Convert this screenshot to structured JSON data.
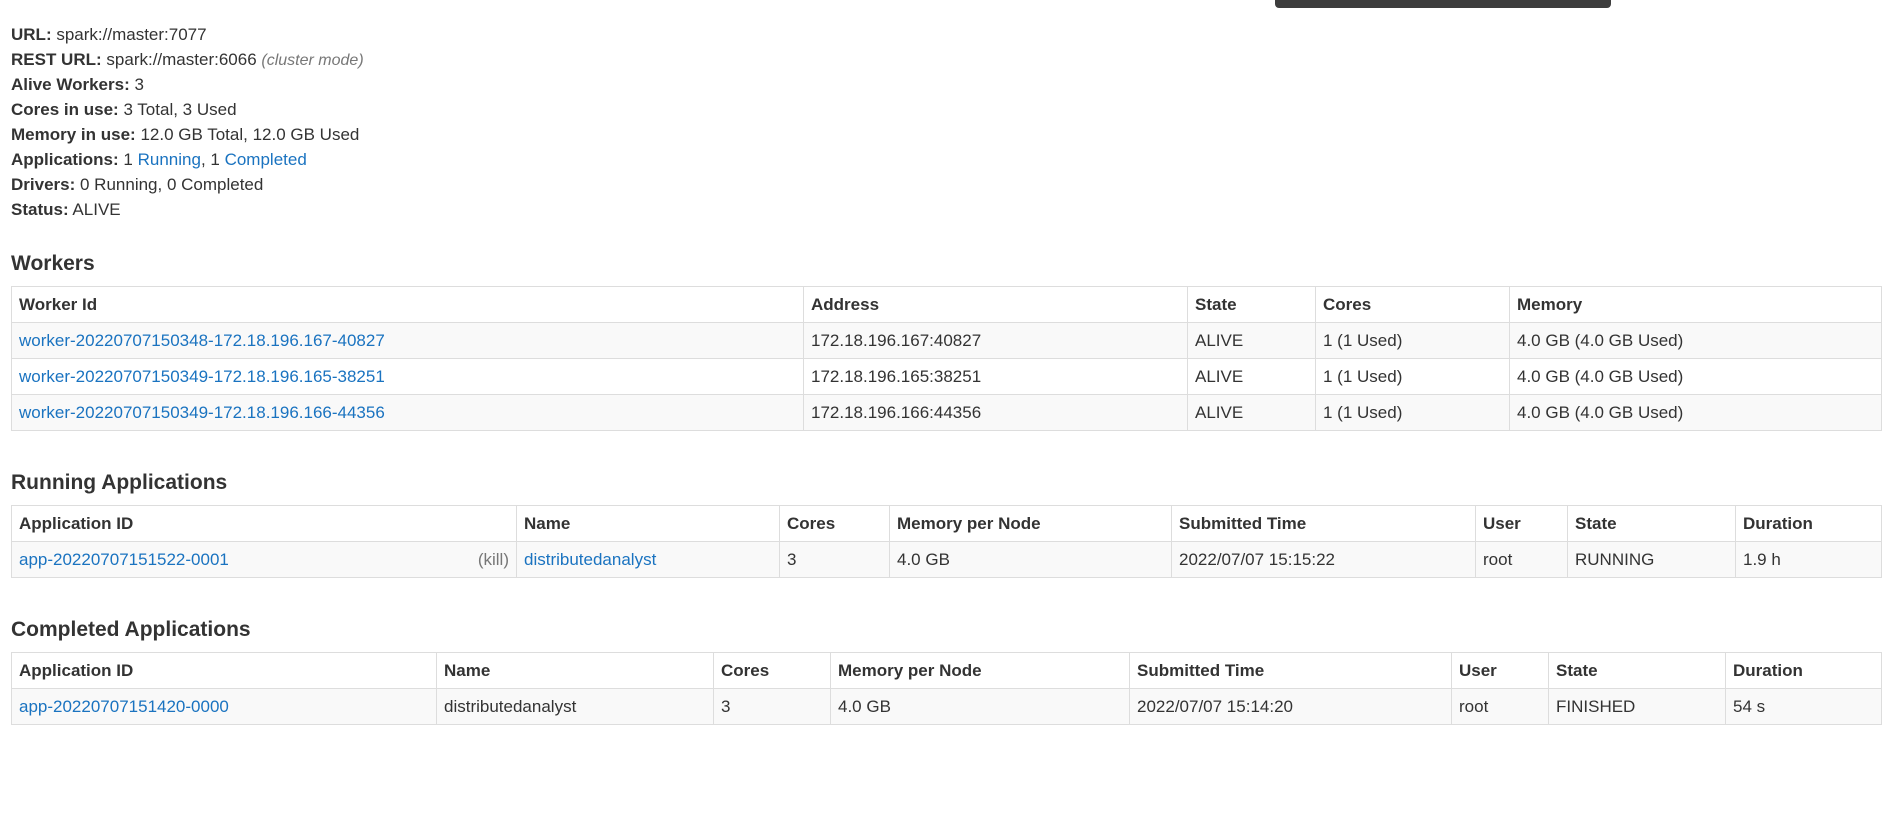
{
  "summary": {
    "url_label": "URL:",
    "url_value": "spark://master:7077",
    "rest_url_label": "REST URL:",
    "rest_url_value": "spark://master:6066",
    "rest_url_note": "(cluster mode)",
    "alive_workers_label": "Alive Workers:",
    "alive_workers_value": "3",
    "cores_label": "Cores in use:",
    "cores_value": "3 Total, 3 Used",
    "memory_label": "Memory in use:",
    "memory_value": "12.0 GB Total, 12.0 GB Used",
    "applications_label": "Applications:",
    "applications_running_count": "1",
    "applications_running_link": "Running",
    "applications_sep": ", 1",
    "applications_completed_link": "Completed",
    "drivers_label": "Drivers:",
    "drivers_value": "0 Running, 0 Completed",
    "status_label": "Status:",
    "status_value": "ALIVE"
  },
  "workers": {
    "title": "Workers",
    "headers": [
      "Worker Id",
      "Address",
      "State",
      "Cores",
      "Memory"
    ],
    "rows": [
      {
        "id": "worker-20220707150348-172.18.196.167-40827",
        "address": "172.18.196.167:40827",
        "state": "ALIVE",
        "cores": "1 (1 Used)",
        "memory": "4.0 GB (4.0 GB Used)"
      },
      {
        "id": "worker-20220707150349-172.18.196.165-38251",
        "address": "172.18.196.165:38251",
        "state": "ALIVE",
        "cores": "1 (1 Used)",
        "memory": "4.0 GB (4.0 GB Used)"
      },
      {
        "id": "worker-20220707150349-172.18.196.166-44356",
        "address": "172.18.196.166:44356",
        "state": "ALIVE",
        "cores": "1 (1 Used)",
        "memory": "4.0 GB (4.0 GB Used)"
      }
    ]
  },
  "running": {
    "title": "Running Applications",
    "headers": [
      "Application ID",
      "Name",
      "Cores",
      "Memory per Node",
      "Submitted Time",
      "User",
      "State",
      "Duration"
    ],
    "rows": [
      {
        "id": "app-20220707151522-0001",
        "kill": "(kill)",
        "name": "distributedanalyst",
        "cores": "3",
        "memory": "4.0 GB",
        "submitted": "2022/07/07 15:15:22",
        "user": "root",
        "state": "RUNNING",
        "duration": "1.9 h"
      }
    ]
  },
  "completed": {
    "title": "Completed Applications",
    "headers": [
      "Application ID",
      "Name",
      "Cores",
      "Memory per Node",
      "Submitted Time",
      "User",
      "State",
      "Duration"
    ],
    "rows": [
      {
        "id": "app-20220707151420-0000",
        "name": "distributedanalyst",
        "cores": "3",
        "memory": "4.0 GB",
        "submitted": "2022/07/07 15:14:20",
        "user": "root",
        "state": "FINISHED",
        "duration": "54 s"
      }
    ]
  }
}
